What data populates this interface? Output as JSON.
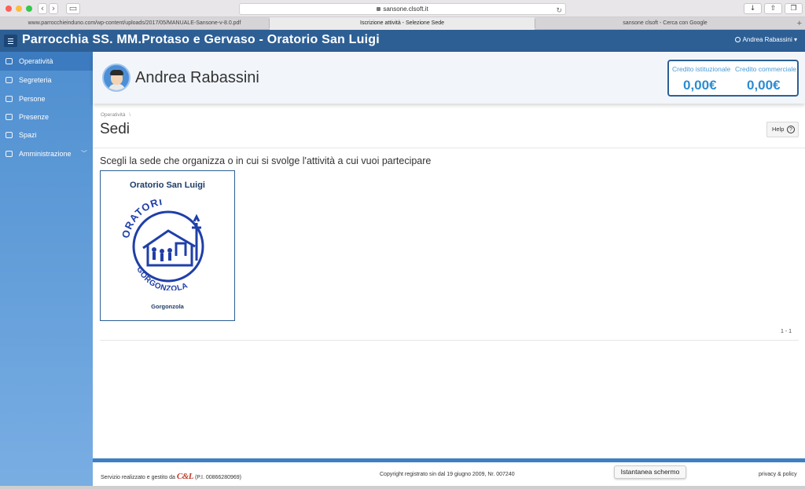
{
  "browser": {
    "address": "sansone.clsoft.it",
    "tabs": [
      {
        "label": "www.parrocchieinduno.com/wp-content/uploads/2017/05/MANUALE-Sansone-v-8.0.pdf",
        "active": false
      },
      {
        "label": "Iscrizione attività - Selezione Sede",
        "active": true
      },
      {
        "label": "sansone clsoft - Cerca con Google",
        "active": false
      }
    ]
  },
  "header": {
    "title": "Parrocchia SS. MM.Protaso e Gervaso - Oratorio San Luigi",
    "user": "Andrea Rabassini"
  },
  "sidebar": {
    "items": [
      {
        "label": "Operatività",
        "icon": "home-icon",
        "active": true
      },
      {
        "label": "Segreteria",
        "icon": "gear-icon",
        "active": false
      },
      {
        "label": "Persone",
        "icon": "document-icon",
        "active": false
      },
      {
        "label": "Presenze",
        "icon": "folder-icon",
        "active": false
      },
      {
        "label": "Spazi",
        "icon": "building-icon",
        "active": false
      },
      {
        "label": "Amministrazione",
        "icon": "settings-icon",
        "active": false,
        "expandable": true
      }
    ]
  },
  "profile": {
    "name": "Andrea Rabassini",
    "credito_istituzionale_label": "Credito istituzionale",
    "credito_istituzionale": "0,00€",
    "credito_commerciale_label": "Credito commerciale",
    "credito_commerciale": "0,00€"
  },
  "content": {
    "breadcrumb": "Operatività",
    "breadcrumb_sep": "\\",
    "title": "Sedi",
    "help_label": "Help",
    "instruction": "Scegli la sede che organizza o in cui si svolge l'attività a cui vuoi partecipare",
    "sede": {
      "name": "Oratorio San Luigi",
      "location": "Gorgonzola",
      "logo_text_top": "ORATORI",
      "logo_text_bottom": "GORGONZOLA"
    },
    "pager": "1 - 1"
  },
  "footer": {
    "left_text": "Servizio realizzato e gestito da",
    "logo": "C&L",
    "piva": "(P.I. 00866280969)",
    "copyright": "Copyright registrato sin dal 19 giugno 2009, Nr. 007240",
    "snapshot_tooltip": "Istantanea schermo",
    "privacy": "privacy & policy"
  },
  "colors": {
    "header": "#2d5f95",
    "sidebar_top": "#4f8fd0",
    "accent": "#2d8bd0"
  }
}
